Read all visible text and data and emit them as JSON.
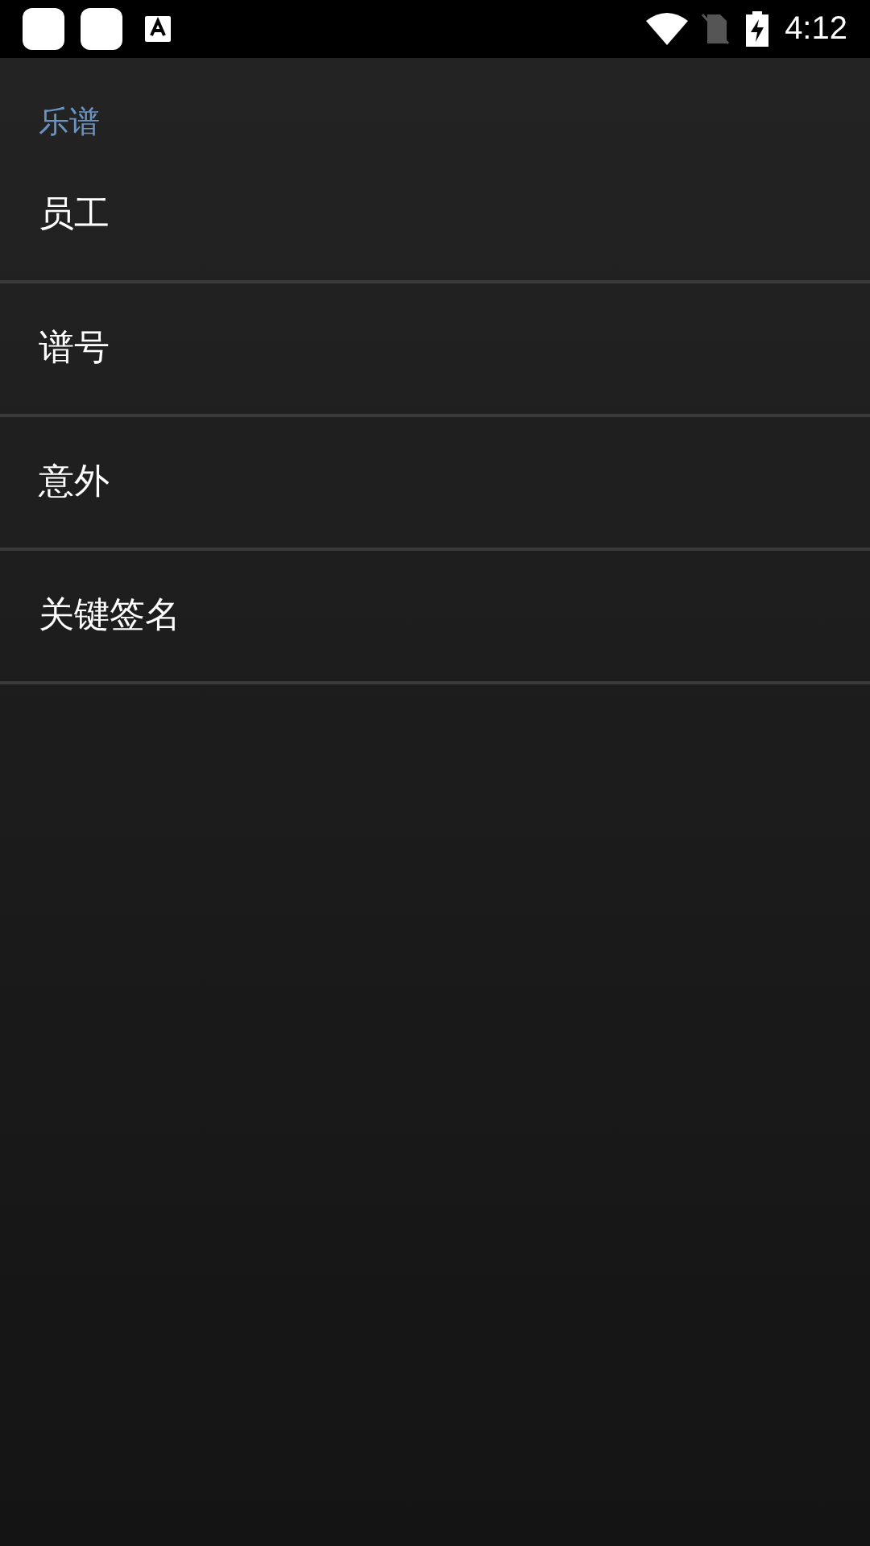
{
  "status_bar": {
    "time": "4:12"
  },
  "section": {
    "title": "乐谱"
  },
  "items": [
    {
      "label": "员工"
    },
    {
      "label": "谱号"
    },
    {
      "label": "意外"
    },
    {
      "label": "关键签名"
    }
  ]
}
